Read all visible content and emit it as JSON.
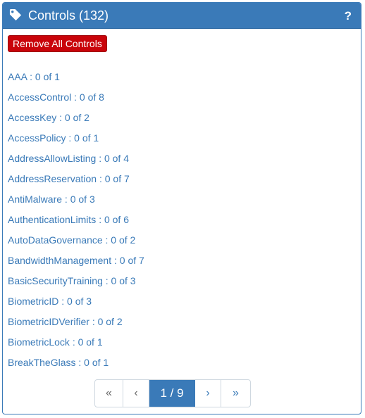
{
  "header": {
    "title": "Controls (132)",
    "help_label": "?"
  },
  "actions": {
    "remove_all_label": "Remove All Controls"
  },
  "controls": [
    {
      "name": "AAA",
      "status": ": 0 of 1"
    },
    {
      "name": "AccessControl",
      "status": ": 0 of 8"
    },
    {
      "name": "AccessKey",
      "status": ": 0 of 2"
    },
    {
      "name": "AccessPolicy",
      "status": ": 0 of 1"
    },
    {
      "name": "AddressAllowListing",
      "status": ": 0 of 4"
    },
    {
      "name": "AddressReservation",
      "status": ": 0 of 7"
    },
    {
      "name": "AntiMalware",
      "status": ": 0 of 3"
    },
    {
      "name": "AuthenticationLimits",
      "status": ": 0 of 6"
    },
    {
      "name": "AutoDataGovernance",
      "status": ": 0 of 2"
    },
    {
      "name": "BandwidthManagement",
      "status": ": 0 of 7"
    },
    {
      "name": "BasicSecurityTraining",
      "status": ": 0 of 3"
    },
    {
      "name": "BiometricID",
      "status": ": 0 of 3"
    },
    {
      "name": "BiometricIDVerifier",
      "status": ": 0 of 2"
    },
    {
      "name": "BiometricLock",
      "status": ": 0 of 1"
    },
    {
      "name": "BreakTheGlass",
      "status": ": 0 of 1"
    }
  ],
  "pagination": {
    "first_label": "«",
    "prev_label": "‹",
    "current_label": "1 / 9",
    "next_label": "›",
    "last_label": "»"
  },
  "colors": {
    "accent": "#3a7ab8",
    "danger": "#c9040a",
    "text": "#333333"
  },
  "icons": {
    "header_icon": "tag-icon",
    "help_icon": "question-icon"
  }
}
